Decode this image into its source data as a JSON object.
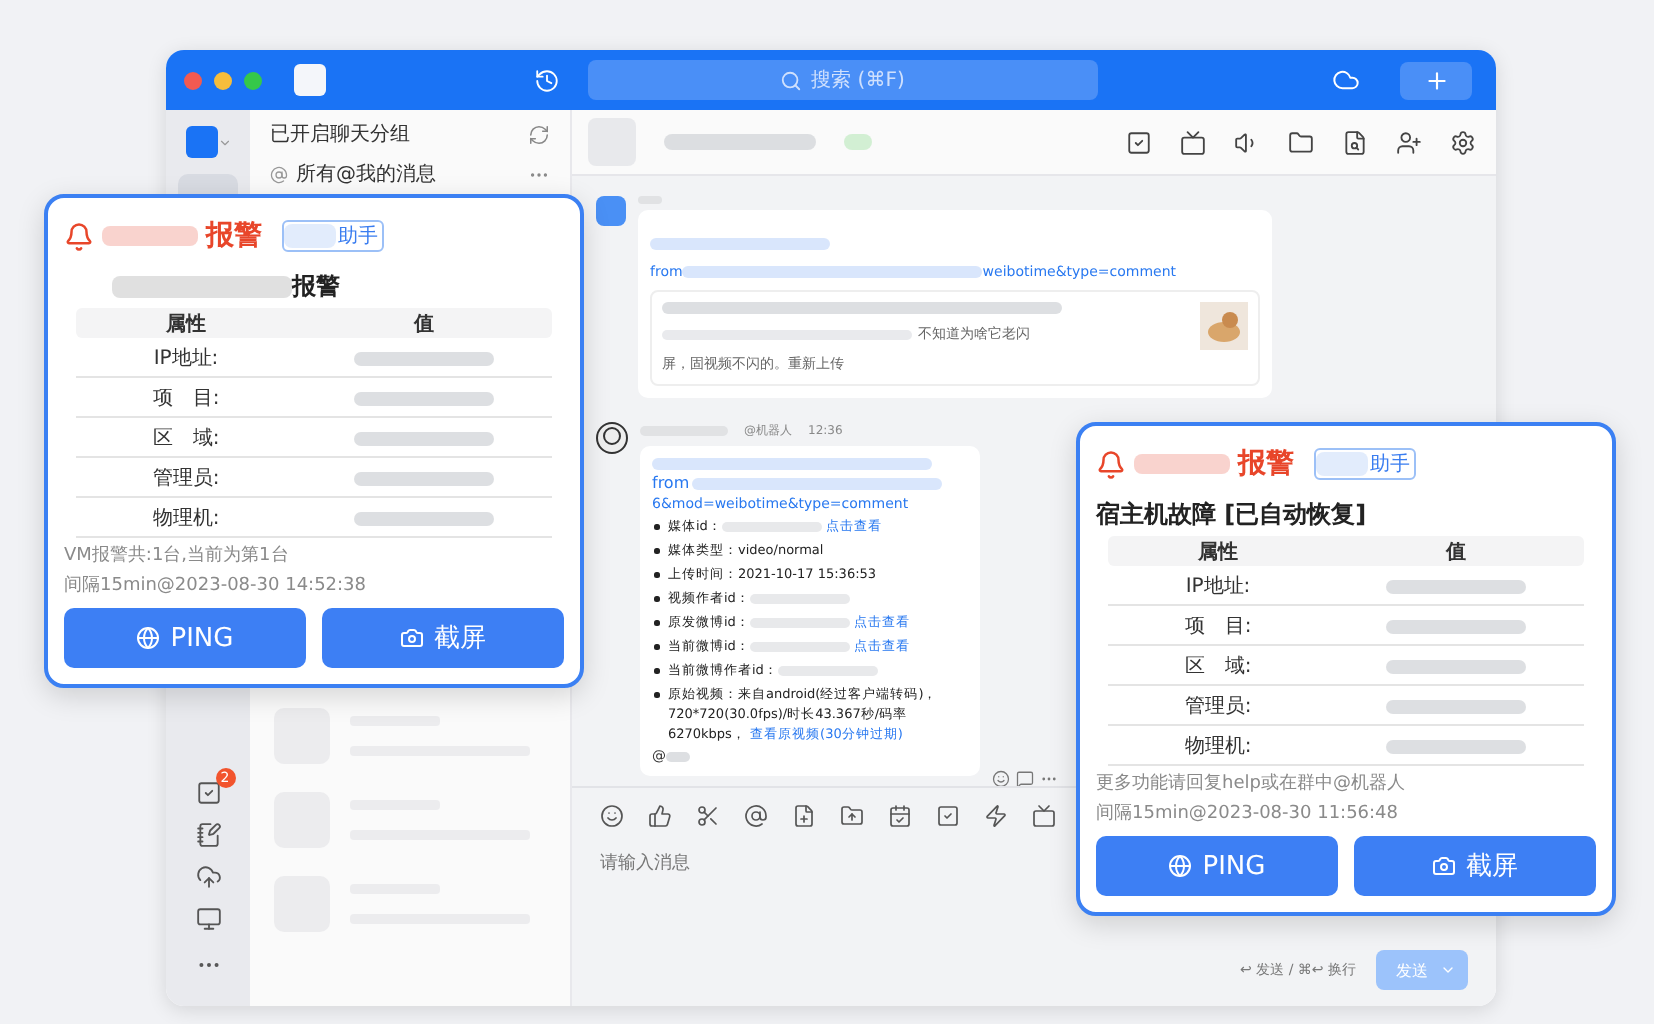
{
  "window": {
    "search_placeholder": "搜索 (⌘F)"
  },
  "sidebar": {
    "badge": "2"
  },
  "chat_list": {
    "header": "已开启聊天分组",
    "mentions": "所有@我的消息"
  },
  "messages": [
    {
      "kind": "link_card",
      "link_head": "from",
      "link_tail": "weibotime&type=comment",
      "preview_text": "不知道为啥它老闪",
      "preview_text_2": "屏，固视频不闪的。重新上传"
    },
    {
      "kind": "bot",
      "sender_tag": "@机器人",
      "time": "12:36",
      "link_head": "from",
      "link_line_3": "6&mod=weibotime&type=comment",
      "at": "@",
      "bullets": [
        {
          "label": "媒体id：",
          "redacted": true,
          "link": "点击查看"
        },
        {
          "label": "媒体类型：",
          "value": "video/normal",
          "redacted": false
        },
        {
          "label": "上传时间：",
          "value": "2021-10-17 15:36:53",
          "redacted": false
        },
        {
          "label": "视频作者id：",
          "redacted": true
        },
        {
          "label": "原发微博id：",
          "redacted": true,
          "link": "点击查看"
        },
        {
          "label": "当前微博id：",
          "redacted": true,
          "link": "点击查看"
        },
        {
          "label": "当前微博作者id：",
          "redacted": true
        },
        {
          "label": "原始视频：",
          "value": "来自android(经过客户端转码)，720*720(30.0fps)/时长43.367秒/码率6270kbps，",
          "link": "查看原视频(30分钟过期)",
          "redacted": false
        }
      ]
    }
  ],
  "composer": {
    "placeholder": "请输入消息",
    "hint": "↩ 发送 / ⌘↩ 换行",
    "send": "发送",
    "send_disabled": true
  },
  "cards": [
    {
      "alert": "报警",
      "tag": "助手",
      "heading": "报警",
      "heading_redacted": true,
      "columns": [
        "属性",
        "值"
      ],
      "rows": [
        {
          "label": "IP地址:"
        },
        {
          "label": "项　目:"
        },
        {
          "label": "区　域:"
        },
        {
          "label": "管理员:"
        },
        {
          "label": "物理机:"
        }
      ],
      "footer": [
        "VM报警共:1台,当前为第1台",
        "间隔15min@2023-08-30 14:52:38"
      ],
      "buttons": [
        {
          "kind": "ping",
          "label": "PING"
        },
        {
          "kind": "screenshot",
          "label": "截屏"
        }
      ]
    },
    {
      "alert": "报警",
      "tag": "助手",
      "heading": "宿主机故障 [已自动恢复]",
      "heading_redacted": false,
      "columns": [
        "属性",
        "值"
      ],
      "rows": [
        {
          "label": "IP地址:"
        },
        {
          "label": "项　目:"
        },
        {
          "label": "区　域:"
        },
        {
          "label": "管理员:"
        },
        {
          "label": "物理机:"
        }
      ],
      "footer": [
        "更多功能请回复help或在群中@机器人",
        "间隔15min@2023-08-30 11:56:48"
      ],
      "buttons": [
        {
          "kind": "ping",
          "label": "PING"
        },
        {
          "kind": "screenshot",
          "label": "截屏"
        }
      ]
    }
  ]
}
